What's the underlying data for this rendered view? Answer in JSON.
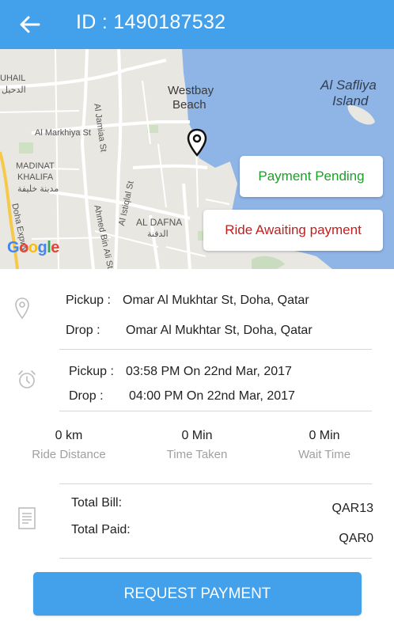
{
  "header": {
    "title": "ID :  1490187532",
    "back_icon": "arrow-left-icon",
    "color": "#43a0ea"
  },
  "map": {
    "labels": {
      "uhail": "UHAIL",
      "uhail_ar": "الدحيل",
      "westbay": "Westbay\nBeach",
      "westbay_line1": "Westbay",
      "westbay_line2": "Beach",
      "safliya_line1": "Al Safliya",
      "safliya_line2": "Island",
      "jamiaa": "Al Jamiaa St",
      "markhiya": "Al Markhiya St",
      "madinat1": "MADINAT",
      "madinat2": "KHALIFA",
      "madinat_ar": "مدينة خليفة",
      "doha_exwy": "Doha Expwy",
      "ahmed": "Ahmed Bin Ali St",
      "istiqlal": "Al Istiqlal St",
      "dafna": "AL DAFNA",
      "dafna_ar": "الدفنة"
    },
    "google_logo": "Google",
    "pin_icon": "map-pin-icon",
    "badges": {
      "pending": "Payment Pending",
      "awaiting": "Ride Awaiting payment",
      "pending_color": "#1aa125",
      "awaiting_color": "#c01f1f"
    }
  },
  "location": {
    "icon": "location-pin-icon",
    "pickup_label": "Pickup :",
    "pickup_value": "Omar Al Mukhtar St, Doha, Qatar",
    "drop_label": "Drop :",
    "drop_value": "Omar Al Mukhtar St, Doha, Qatar"
  },
  "time": {
    "icon": "alarm-clock-icon",
    "pickup_label": "Pickup :",
    "pickup_value": "03:58 PM On 22nd Mar, 2017",
    "drop_label": "Drop :",
    "drop_value": "04:00 PM On 22nd Mar, 2017"
  },
  "stats": [
    {
      "value": "0 km",
      "label": "Ride Distance"
    },
    {
      "value": "0 Min",
      "label": "Time Taken"
    },
    {
      "value": "0 Min",
      "label": "Wait Time"
    }
  ],
  "bill": {
    "icon": "receipt-icon",
    "total_bill_label": "Total Bill:",
    "total_bill_value": "QAR13",
    "total_paid_label": "Total Paid:",
    "total_paid_value": "QAR0"
  },
  "action": {
    "button_label": "REQUEST PAYMENT"
  }
}
